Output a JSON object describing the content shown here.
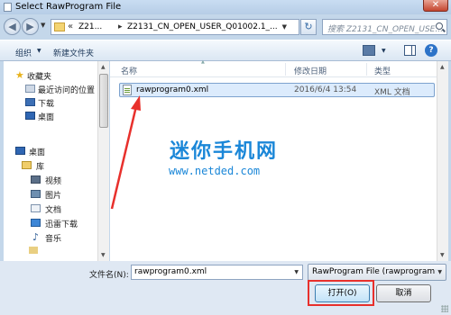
{
  "window": {
    "title": "Select RawProgram File",
    "close": "✕"
  },
  "address": {
    "chevron": "«",
    "crumb1": "Z21...",
    "separator": "▸",
    "crumb2": "Z2131_CN_OPEN_USER_Q01002.1_...",
    "search_placeholder": "搜索 Z2131_CN_OPEN_USE..."
  },
  "toolbar": {
    "organize": "组织",
    "new_folder": "新建文件夹"
  },
  "sidebar": {
    "items": [
      {
        "label": "收藏夹",
        "icon": "star-icon"
      },
      {
        "label": "最近访问的位置",
        "icon": "recent-places-icon"
      },
      {
        "label": "下载",
        "icon": "downloads-icon"
      },
      {
        "label": "桌面",
        "icon": "desktop-icon"
      },
      {
        "label": "桌面",
        "icon": "desktop-icon"
      },
      {
        "label": "库",
        "icon": "library-icon"
      },
      {
        "label": "视频",
        "icon": "video-icon"
      },
      {
        "label": "图片",
        "icon": "picture-icon"
      },
      {
        "label": "文档",
        "icon": "document-icon"
      },
      {
        "label": "迅雷下载",
        "icon": "thunder-download-icon"
      },
      {
        "label": "音乐",
        "icon": "music-icon"
      }
    ]
  },
  "filelist": {
    "columns": {
      "name": "名称",
      "date": "修改日期",
      "type": "类型"
    },
    "files": [
      {
        "name": "rawprogram0.xml",
        "date": "2016/6/4 13:54",
        "type": "XML 文档"
      }
    ]
  },
  "watermark": {
    "title": "迷你手机网",
    "url": "www.netded.com"
  },
  "footer": {
    "filename_label": "文件名(N):",
    "filename_value": "rawprogram0.xml",
    "filetype_value": "RawProgram File (rawprogram",
    "open_button": "打开(O)",
    "cancel_button": "取消"
  },
  "colors": {
    "accent": "#1b87d8",
    "highlight": "#e8302c",
    "selection": "#dcebfc"
  }
}
